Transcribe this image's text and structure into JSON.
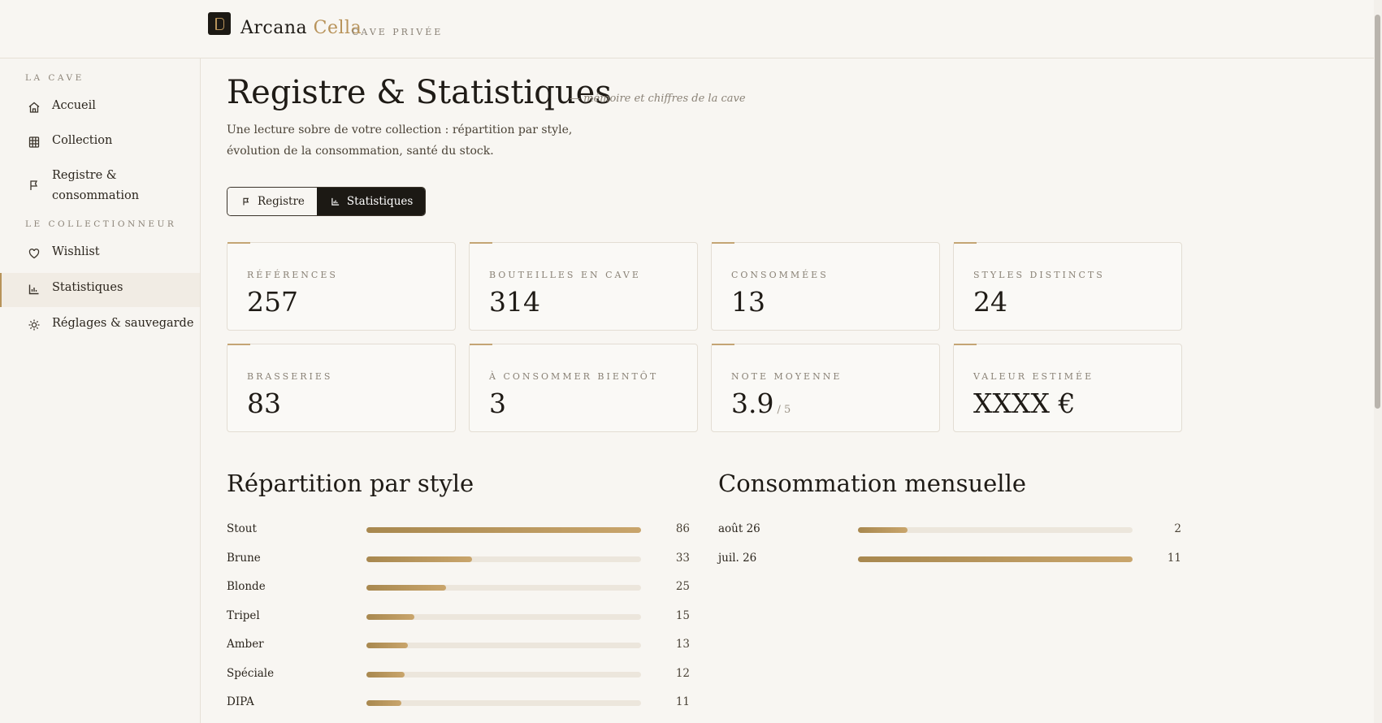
{
  "header": {
    "brand_a": "Arcana",
    "brand_b": "Cella",
    "brand_sub": "CAVE PRIVÉE",
    "logo_icon": "door-icon"
  },
  "sidebar": {
    "section_cave": "LA CAVE",
    "section_collector": "LE COLLECTIONNEUR",
    "items": [
      {
        "label": "Accueil",
        "icon": "home-icon"
      },
      {
        "label": "Collection",
        "icon": "grid-icon"
      },
      {
        "label": "Registre & consommation",
        "icon": "flag-icon"
      },
      {
        "label": "Wishlist",
        "icon": "heart-icon"
      },
      {
        "label": "Statistiques",
        "icon": "bar-chart-icon",
        "active": true
      },
      {
        "label": "Réglages & sauvegarde",
        "icon": "sun-icon"
      }
    ]
  },
  "page": {
    "title": "Registre & Statistiques",
    "subtitle": "— mémoire et chiffres de la cave",
    "intro": "Une lecture sobre de votre collection : répartition par style, évolution de la consommation, santé du stock."
  },
  "tabs": {
    "registre": "Registre",
    "statistiques": "Statistiques",
    "active": "statistiques"
  },
  "stats": [
    {
      "label": "RÉFÉRENCES",
      "value": "257"
    },
    {
      "label": "BOUTEILLES EN CAVE",
      "value": "314"
    },
    {
      "label": "CONSOMMÉES",
      "value": "13"
    },
    {
      "label": "STYLES DISTINCTS",
      "value": "24"
    },
    {
      "label": "BRASSERIES",
      "value": "83"
    },
    {
      "label": "À CONSOMMER BIENTÔT",
      "value": "3"
    },
    {
      "label": "NOTE MOYENNE",
      "value": "3.9",
      "unit": "/ 5"
    },
    {
      "label": "VALEUR ESTIMÉE",
      "value": "XXXX €"
    }
  ],
  "colors": {
    "accent": "#b8935a",
    "bar_start": "#a8884f",
    "bar_end": "#c9a56c",
    "track": "#ece6dc",
    "dark": "#1c1914"
  },
  "chart_data": [
    {
      "type": "bar",
      "title": "Répartition par style",
      "categories": [
        "Stout",
        "Brune",
        "Blonde",
        "Tripel",
        "Amber",
        "Spéciale",
        "DIPA"
      ],
      "values": [
        86,
        33,
        25,
        15,
        13,
        12,
        11
      ],
      "orientation": "horizontal",
      "xlim": [
        0,
        86
      ]
    },
    {
      "type": "bar",
      "title": "Consommation mensuelle",
      "categories": [
        "août 26",
        "juil. 26"
      ],
      "values": [
        2,
        11
      ],
      "orientation": "horizontal",
      "xlim": [
        0,
        11
      ]
    }
  ]
}
